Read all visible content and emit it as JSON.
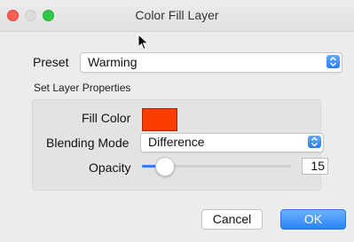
{
  "window": {
    "title": "Color Fill Layer"
  },
  "preset": {
    "label": "Preset",
    "value": "Warming"
  },
  "group": {
    "title": "Set Layer Properties"
  },
  "fill_color": {
    "label": "Fill Color",
    "color": "#fa3c00"
  },
  "blending": {
    "label": "Blending Mode",
    "value": "Difference"
  },
  "opacity": {
    "label": "Opacity",
    "value": "15",
    "fraction": 0.15
  },
  "buttons": {
    "cancel": "Cancel",
    "ok": "OK"
  },
  "colors": {
    "accent": "#2f80f5",
    "close": "#fd5f57",
    "zoom": "#34c84a"
  },
  "icons": {
    "cursor": "arrow-cursor-icon",
    "stepper": "chevron-updown-icon"
  }
}
